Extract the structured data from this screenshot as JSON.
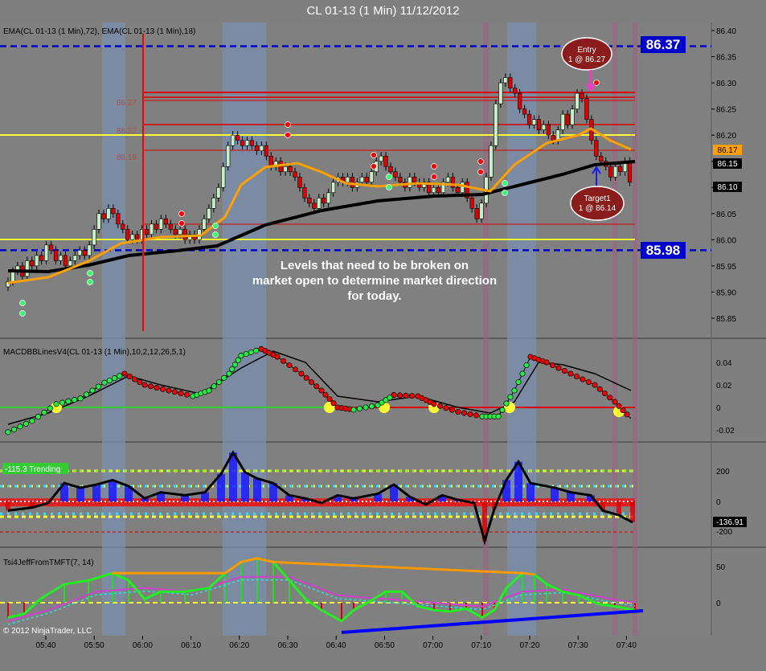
{
  "window": {
    "title": "CL 01-13 (1 Min)  11/12/2012",
    "copyright": "© 2012 NinjaTrader, LLC"
  },
  "colors": {
    "background": "#7f7f7f",
    "up_candle": "#c8f0c8",
    "down_candle": "#e00000",
    "ema_fast": "#ffa000",
    "ema_slow": "#000000",
    "level_blue": "#0000cc",
    "level_yellow": "#ffff33",
    "level_red": "#dd0000",
    "vertical_line": "#ff0000",
    "session_band": "#7a8fb0",
    "trend_line": "#0000ff"
  },
  "price_panel": {
    "indicator_label": "EMA(CL 01-13 (1 Min),72), EMA(CL 01-13 (1 Min),18)",
    "y_ticks": [
      "86.40",
      "86.35",
      "86.30",
      "86.25",
      "86.20",
      "86.15",
      "86.10",
      "86.05",
      "86.00",
      "85.95",
      "85.90",
      "85.85"
    ],
    "tag_high": "86.37",
    "tag_low": "85.98",
    "tag_ema_fast": "86.17",
    "tag_ema_slow": "86.15",
    "tag_last": "86.10",
    "faded_labels": [
      "86.27",
      "86.22",
      "86.18"
    ],
    "annotation": "Levels that need to be broken on market open to determine market direction for today.",
    "annotation_lines": [
      "Levels that need to be broken on",
      "market open to determine market direction",
      "for today."
    ],
    "entry_line1": "Entry",
    "entry_line2": "1 @ 86.27",
    "target_line1": "Target1",
    "target_line2": "1 @ 86.14"
  },
  "macd_panel": {
    "label": "MACDBBLinesV4(CL 01-13 (1 Min),10,2,12,26,5,1)",
    "y_ticks": [
      "0.04",
      "0.02",
      "0",
      "-0.02"
    ]
  },
  "trend_panel": {
    "label": "-115.3 Trending",
    "y_ticks": [
      "200",
      "0",
      "-200"
    ],
    "current_value": "-136.91"
  },
  "tsi_panel": {
    "label": "Tsi4JeffFromTMFT(7, 14)",
    "y_ticks": [
      "50",
      "0"
    ]
  },
  "x_axis": {
    "ticks": [
      "05:40",
      "05:50",
      "06:00",
      "06:10",
      "06:20",
      "06:30",
      "06:40",
      "06:50",
      "07:00",
      "07:10",
      "07:20",
      "07:30",
      "07:40"
    ]
  }
}
